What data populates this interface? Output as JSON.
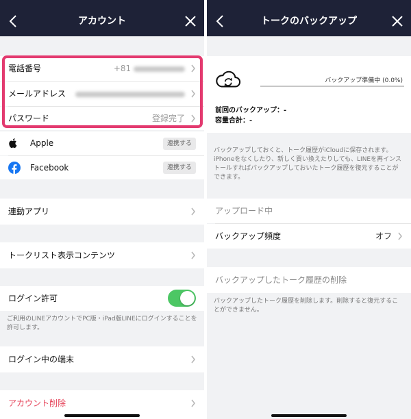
{
  "left": {
    "title": "アカウント",
    "rows": {
      "phone": {
        "label": "電話番号",
        "value_prefix": "+81"
      },
      "email": {
        "label": "メールアドレス"
      },
      "password": {
        "label": "パスワード",
        "value": "登録完了"
      }
    },
    "social": [
      {
        "name": "Apple",
        "icon": "apple-icon",
        "button": "連携する"
      },
      {
        "name": "Facebook",
        "icon": "facebook-icon",
        "button": "連携する"
      }
    ],
    "linked_apps": "連動アプリ",
    "talk_list_content": "トークリスト表示コンテンツ",
    "login_permission": {
      "label": "ログイン許可",
      "enabled": true,
      "description": "ご利用のLINEアカウントでPC版・iPad版LINEにログインすることを許可します。"
    },
    "logged_in_devices": "ログイン中の端末",
    "delete_account": "アカウント削除"
  },
  "right": {
    "title": "トークのバックアップ",
    "backup_status": "バックアップ準備中 (0.0%)",
    "progress": 0.0,
    "last_backup": "前回のバックアップ：-",
    "total_size": "容量合計：-",
    "info_text": "バックアップしておくと、トーク履歴がiCloudに保存されます。iPhoneをなくしたり、新しく買い換えたりしても、LINEを再インストールすればバックアップしておいたトーク履歴を復元することができます。",
    "uploading": "アップロード中",
    "frequency": {
      "label": "バックアップ頻度",
      "value": "オフ"
    },
    "delete_history": "バックアップしたトーク履歴の削除",
    "delete_description": "バックアップしたトーク履歴を削除します。削除すると復元することができません。"
  },
  "colors": {
    "navbar": "#1e2237",
    "highlight": "#e33a6f",
    "toggle_on": "#4cc764",
    "danger": "#e6455b",
    "facebook": "#1877f2"
  }
}
